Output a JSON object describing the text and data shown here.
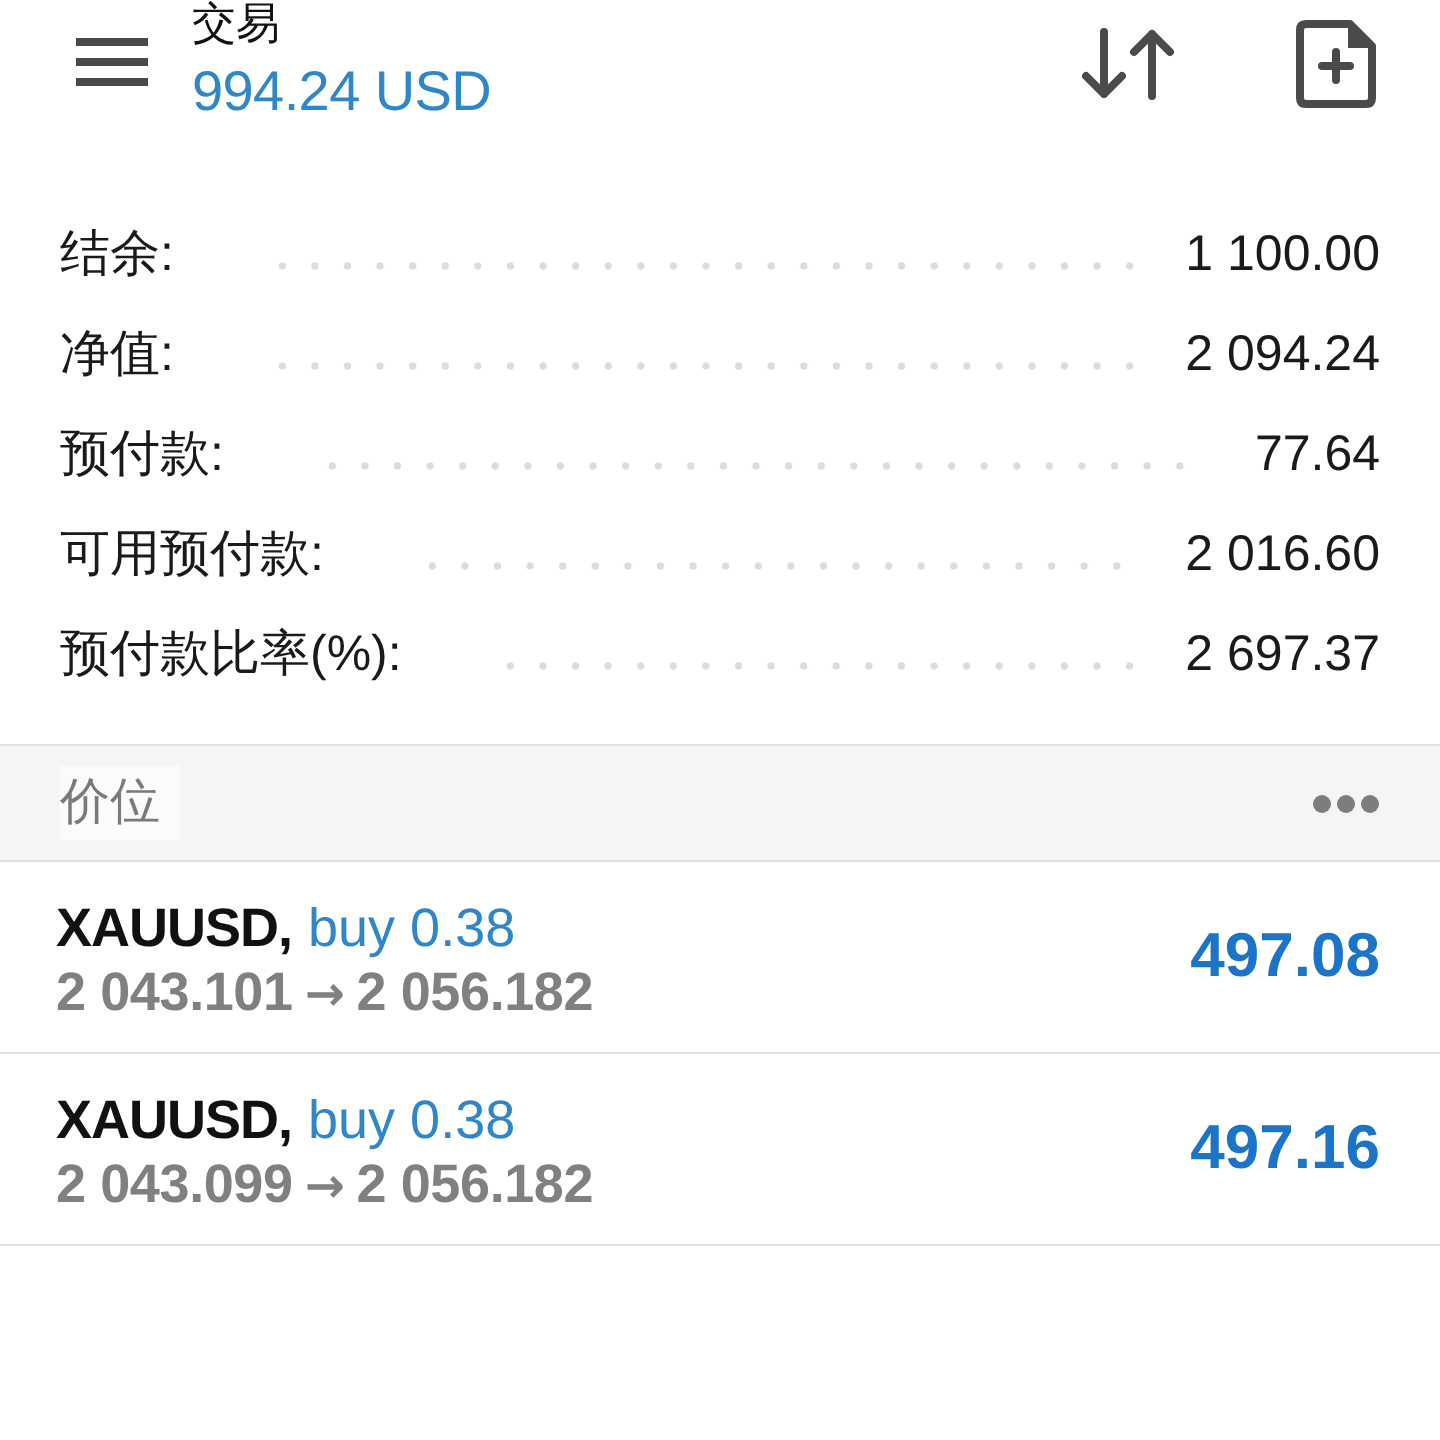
{
  "header": {
    "title": "交易",
    "balance": "994.24 USD"
  },
  "summary": [
    {
      "label": "结余:",
      "value": "1 100.00"
    },
    {
      "label": "净值:",
      "value": "2 094.24"
    },
    {
      "label": "预付款:",
      "value": "77.64"
    },
    {
      "label": "可用预付款:",
      "value": "2 016.60"
    },
    {
      "label": "预付款比率(%):",
      "value": "2 697.37"
    }
  ],
  "section": {
    "title": "价位"
  },
  "positions": [
    {
      "symbol": "XAUUSD,",
      "order": "buy 0.38",
      "open_price": "2 043.101",
      "arrow": "→",
      "close_price": "2 056.182",
      "profit": "497.08"
    },
    {
      "symbol": "XAUUSD,",
      "order": "buy 0.38",
      "open_price": "2 043.099",
      "arrow": "→",
      "close_price": "2 056.182",
      "profit": "497.16"
    }
  ]
}
